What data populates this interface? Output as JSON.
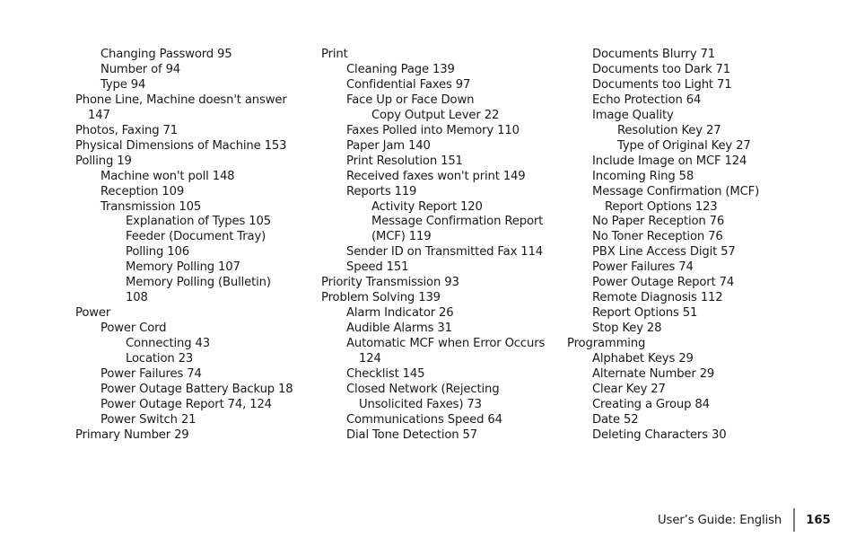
{
  "columns": [
    {
      "entries": [
        {
          "text": "Changing Password  95",
          "level": 1
        },
        {
          "text": "Number of  94",
          "level": 1
        },
        {
          "text": "Type  94",
          "level": 1
        },
        {
          "text": "Phone Line, Machine doesn't answer",
          "level": 0
        },
        {
          "text": "147",
          "level": 0,
          "cont": true
        },
        {
          "text": "Photos, Faxing  71",
          "level": 0
        },
        {
          "text": "Physical Dimensions of Machine  153",
          "level": 0
        },
        {
          "text": "Polling  19",
          "level": 0
        },
        {
          "text": "Machine won't poll  148",
          "level": 1
        },
        {
          "text": "Reception  109",
          "level": 1
        },
        {
          "text": "Transmission  105",
          "level": 1
        },
        {
          "text": "Explanation of Types  105",
          "level": 2
        },
        {
          "text": "Feeder (Document Tray)",
          "level": 2
        },
        {
          "text": "Polling  106",
          "level": 2
        },
        {
          "text": "Memory Polling  107",
          "level": 2
        },
        {
          "text": "Memory Polling (Bulletin)",
          "level": 2
        },
        {
          "text": "108",
          "level": 2,
          "cont": true
        },
        {
          "text": "Power",
          "level": 0
        },
        {
          "text": "Power Cord",
          "level": 1
        },
        {
          "text": "Connecting  43",
          "level": 2
        },
        {
          "text": "Location  23",
          "level": 2
        },
        {
          "text": "Power Failures  74",
          "level": 1
        },
        {
          "text": "Power Outage Battery Backup  18",
          "level": 1
        },
        {
          "text": "Power Outage Report  74, 124",
          "level": 1
        },
        {
          "text": "Power Switch  21",
          "level": 1
        },
        {
          "text": "Primary Number  29",
          "level": 0
        }
      ]
    },
    {
      "entries": [
        {
          "text": "Print",
          "level": 0
        },
        {
          "text": "Cleaning Page  139",
          "level": 1
        },
        {
          "text": "Confidential Faxes  97",
          "level": 1
        },
        {
          "text": "Face Up or Face Down",
          "level": 1
        },
        {
          "text": "Copy Output Lever  22",
          "level": 2
        },
        {
          "text": "Faxes Polled into Memory  110",
          "level": 1
        },
        {
          "text": "Paper Jam  140",
          "level": 1
        },
        {
          "text": "Print Resolution  151",
          "level": 1
        },
        {
          "text": "Received faxes won't print  149",
          "level": 1
        },
        {
          "text": "Reports  119",
          "level": 1
        },
        {
          "text": "Activity Report  120",
          "level": 2
        },
        {
          "text": "Message Confirmation Report",
          "level": 2
        },
        {
          "text": "(MCF)  119",
          "level": 2,
          "cont": true
        },
        {
          "text": "Sender ID on Transmitted Fax  114",
          "level": 1
        },
        {
          "text": "Speed  151",
          "level": 1
        },
        {
          "text": "Priority Transmission  93",
          "level": 0
        },
        {
          "text": "Problem Solving  139",
          "level": 0
        },
        {
          "text": "Alarm Indicator  26",
          "level": 1
        },
        {
          "text": "Audible Alarms  31",
          "level": 1
        },
        {
          "text": "Automatic MCF when Error Occurs",
          "level": 1
        },
        {
          "text": "124",
          "level": 1,
          "cont": true
        },
        {
          "text": "Checklist  145",
          "level": 1
        },
        {
          "text": "Closed Network (Rejecting",
          "level": 1
        },
        {
          "text": "Unsolicited Faxes)  73",
          "level": 1,
          "cont": true
        },
        {
          "text": "Communications Speed  64",
          "level": 1
        },
        {
          "text": "Dial Tone Detection  57",
          "level": 1
        }
      ]
    },
    {
      "entries": [
        {
          "text": "Documents Blurry  71",
          "level": 1
        },
        {
          "text": "Documents too Dark  71",
          "level": 1
        },
        {
          "text": "Documents too Light  71",
          "level": 1
        },
        {
          "text": "Echo Protection  64",
          "level": 1
        },
        {
          "text": "Image Quality",
          "level": 1
        },
        {
          "text": "Resolution Key  27",
          "level": 2
        },
        {
          "text": "Type of Original Key  27",
          "level": 2
        },
        {
          "text": "Include Image on MCF  124",
          "level": 1
        },
        {
          "text": "Incoming Ring  58",
          "level": 1
        },
        {
          "text": "Message Confirmation (MCF)",
          "level": 1
        },
        {
          "text": "Report Options  123",
          "level": 1,
          "cont": true
        },
        {
          "text": "No Paper Reception  76",
          "level": 1
        },
        {
          "text": "No Toner Reception  76",
          "level": 1
        },
        {
          "text": "PBX Line Access Digit  57",
          "level": 1
        },
        {
          "text": "Power Failures  74",
          "level": 1
        },
        {
          "text": "Power Outage Report  74",
          "level": 1
        },
        {
          "text": "Remote Diagnosis  112",
          "level": 1
        },
        {
          "text": "Report Options  51",
          "level": 1
        },
        {
          "text": "Stop Key  28",
          "level": 1
        },
        {
          "text": "Programming",
          "level": 0
        },
        {
          "text": "Alphabet Keys  29",
          "level": 1
        },
        {
          "text": "Alternate Number  29",
          "level": 1
        },
        {
          "text": "Clear Key  27",
          "level": 1
        },
        {
          "text": "Creating a Group  84",
          "level": 1
        },
        {
          "text": "Date  52",
          "level": 1
        },
        {
          "text": "Deleting Characters  30",
          "level": 1
        }
      ]
    }
  ],
  "footer": {
    "guide_label": "User’s Guide:  English",
    "page_number": "165"
  }
}
